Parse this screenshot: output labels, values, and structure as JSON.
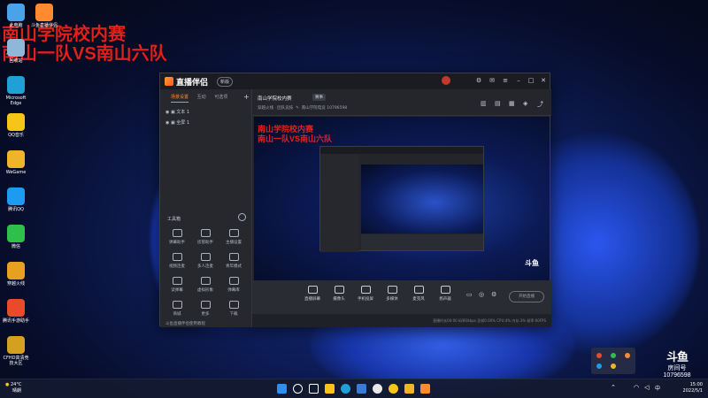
{
  "overlay": {
    "line1": "南山学院校内赛",
    "line2": "南山一队VS南山六队"
  },
  "desktop_icons": [
    {
      "label": "此电脑",
      "color": "#4aa3e8"
    },
    {
      "label": "斗鱼直播伴侣",
      "color": "#ff8a2f"
    },
    {
      "label": "回收站",
      "color": "#8fb8d8"
    },
    {
      "label": "Microsoft Edge",
      "color": "#1fa0d6"
    },
    {
      "label": "QQ音乐",
      "color": "#f5c518"
    },
    {
      "label": "WeGame",
      "color": "#f0b428"
    },
    {
      "label": "腾讯QQ",
      "color": "#1d9bf0"
    },
    {
      "label": "微信",
      "color": "#2ec04a"
    },
    {
      "label": "穿越火线",
      "color": "#e8a020"
    },
    {
      "label": "腾讯手游助手",
      "color": "#e84a2a"
    },
    {
      "label": "CFHD高清竞技大区",
      "color": "#d4a020"
    }
  ],
  "app": {
    "name": "直播伴侣",
    "version": "新版",
    "tabs": [
      {
        "label": "场景设置",
        "active": true
      },
      {
        "label": "互动",
        "active": false
      },
      {
        "label": "可选项",
        "active": false
      }
    ],
    "scenes": [
      {
        "label": "文本 1"
      },
      {
        "label": "全屏 1"
      }
    ],
    "tools_title": "工具箱",
    "tools": [
      {
        "label": "弹幕助手"
      },
      {
        "label": "房管助手"
      },
      {
        "label": "主播设置"
      },
      {
        "label": "视频连麦"
      },
      {
        "label": "多人连麦"
      },
      {
        "label": "青年模式"
      },
      {
        "label": "读弹幕"
      },
      {
        "label": "虚拟形象"
      },
      {
        "label": "弹幕库"
      },
      {
        "label": "商城"
      },
      {
        "label": "更多"
      },
      {
        "label": "下载"
      }
    ],
    "footer_note": "斗鱼直播伴侣使用教程",
    "room": {
      "title": "南山学院校内赛",
      "tag": "赛事",
      "category": "穿越火线 · 团队竞技",
      "meta": "南山学院电竞 10796598"
    },
    "preview": {
      "line1": "南山学院校内赛",
      "line2": "南山一队VS南山六队"
    },
    "controls": [
      {
        "label": "直播屏幕"
      },
      {
        "label": "摄像头"
      },
      {
        "label": "手机投屏"
      },
      {
        "label": "多媒体"
      },
      {
        "label": "麦克风"
      },
      {
        "label": "扬声器"
      }
    ],
    "start_button": "开始直播",
    "status_text": "直播时长00:00  码率0kbps  丢帧0.00%  CPU:4%  内存:3%  帧率:60FPS"
  },
  "watermark": {
    "logo": "斗鱼",
    "sub": "房间号",
    "room_number": "10796598"
  },
  "taskbar": {
    "weather_temp": "24°C",
    "weather_desc": "晴朗",
    "time": "15:00",
    "date": "2022/5/1"
  }
}
